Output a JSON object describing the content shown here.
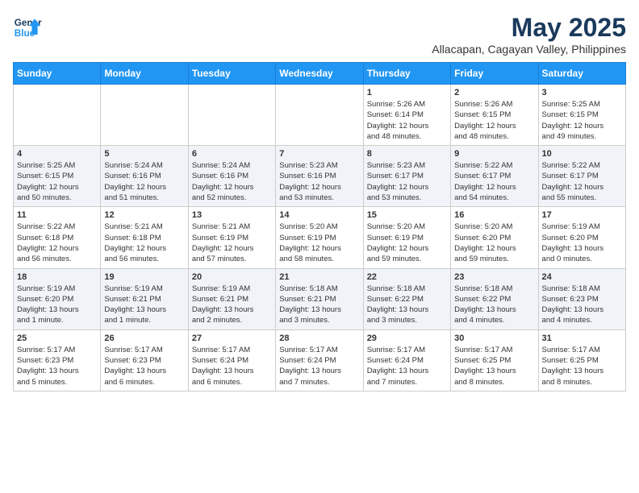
{
  "header": {
    "logo_line1": "General",
    "logo_line2": "Blue",
    "month_title": "May 2025",
    "location": "Allacapan, Cagayan Valley, Philippines"
  },
  "weekdays": [
    "Sunday",
    "Monday",
    "Tuesday",
    "Wednesday",
    "Thursday",
    "Friday",
    "Saturday"
  ],
  "weeks": [
    [
      {
        "day": "",
        "info": ""
      },
      {
        "day": "",
        "info": ""
      },
      {
        "day": "",
        "info": ""
      },
      {
        "day": "",
        "info": ""
      },
      {
        "day": "1",
        "info": "Sunrise: 5:26 AM\nSunset: 6:14 PM\nDaylight: 12 hours\nand 48 minutes."
      },
      {
        "day": "2",
        "info": "Sunrise: 5:26 AM\nSunset: 6:15 PM\nDaylight: 12 hours\nand 48 minutes."
      },
      {
        "day": "3",
        "info": "Sunrise: 5:25 AM\nSunset: 6:15 PM\nDaylight: 12 hours\nand 49 minutes."
      }
    ],
    [
      {
        "day": "4",
        "info": "Sunrise: 5:25 AM\nSunset: 6:15 PM\nDaylight: 12 hours\nand 50 minutes."
      },
      {
        "day": "5",
        "info": "Sunrise: 5:24 AM\nSunset: 6:16 PM\nDaylight: 12 hours\nand 51 minutes."
      },
      {
        "day": "6",
        "info": "Sunrise: 5:24 AM\nSunset: 6:16 PM\nDaylight: 12 hours\nand 52 minutes."
      },
      {
        "day": "7",
        "info": "Sunrise: 5:23 AM\nSunset: 6:16 PM\nDaylight: 12 hours\nand 53 minutes."
      },
      {
        "day": "8",
        "info": "Sunrise: 5:23 AM\nSunset: 6:17 PM\nDaylight: 12 hours\nand 53 minutes."
      },
      {
        "day": "9",
        "info": "Sunrise: 5:22 AM\nSunset: 6:17 PM\nDaylight: 12 hours\nand 54 minutes."
      },
      {
        "day": "10",
        "info": "Sunrise: 5:22 AM\nSunset: 6:17 PM\nDaylight: 12 hours\nand 55 minutes."
      }
    ],
    [
      {
        "day": "11",
        "info": "Sunrise: 5:22 AM\nSunset: 6:18 PM\nDaylight: 12 hours\nand 56 minutes."
      },
      {
        "day": "12",
        "info": "Sunrise: 5:21 AM\nSunset: 6:18 PM\nDaylight: 12 hours\nand 56 minutes."
      },
      {
        "day": "13",
        "info": "Sunrise: 5:21 AM\nSunset: 6:19 PM\nDaylight: 12 hours\nand 57 minutes."
      },
      {
        "day": "14",
        "info": "Sunrise: 5:20 AM\nSunset: 6:19 PM\nDaylight: 12 hours\nand 58 minutes."
      },
      {
        "day": "15",
        "info": "Sunrise: 5:20 AM\nSunset: 6:19 PM\nDaylight: 12 hours\nand 59 minutes."
      },
      {
        "day": "16",
        "info": "Sunrise: 5:20 AM\nSunset: 6:20 PM\nDaylight: 12 hours\nand 59 minutes."
      },
      {
        "day": "17",
        "info": "Sunrise: 5:19 AM\nSunset: 6:20 PM\nDaylight: 13 hours\nand 0 minutes."
      }
    ],
    [
      {
        "day": "18",
        "info": "Sunrise: 5:19 AM\nSunset: 6:20 PM\nDaylight: 13 hours\nand 1 minute."
      },
      {
        "day": "19",
        "info": "Sunrise: 5:19 AM\nSunset: 6:21 PM\nDaylight: 13 hours\nand 1 minute."
      },
      {
        "day": "20",
        "info": "Sunrise: 5:19 AM\nSunset: 6:21 PM\nDaylight: 13 hours\nand 2 minutes."
      },
      {
        "day": "21",
        "info": "Sunrise: 5:18 AM\nSunset: 6:21 PM\nDaylight: 13 hours\nand 3 minutes."
      },
      {
        "day": "22",
        "info": "Sunrise: 5:18 AM\nSunset: 6:22 PM\nDaylight: 13 hours\nand 3 minutes."
      },
      {
        "day": "23",
        "info": "Sunrise: 5:18 AM\nSunset: 6:22 PM\nDaylight: 13 hours\nand 4 minutes."
      },
      {
        "day": "24",
        "info": "Sunrise: 5:18 AM\nSunset: 6:23 PM\nDaylight: 13 hours\nand 4 minutes."
      }
    ],
    [
      {
        "day": "25",
        "info": "Sunrise: 5:17 AM\nSunset: 6:23 PM\nDaylight: 13 hours\nand 5 minutes."
      },
      {
        "day": "26",
        "info": "Sunrise: 5:17 AM\nSunset: 6:23 PM\nDaylight: 13 hours\nand 6 minutes."
      },
      {
        "day": "27",
        "info": "Sunrise: 5:17 AM\nSunset: 6:24 PM\nDaylight: 13 hours\nand 6 minutes."
      },
      {
        "day": "28",
        "info": "Sunrise: 5:17 AM\nSunset: 6:24 PM\nDaylight: 13 hours\nand 7 minutes."
      },
      {
        "day": "29",
        "info": "Sunrise: 5:17 AM\nSunset: 6:24 PM\nDaylight: 13 hours\nand 7 minutes."
      },
      {
        "day": "30",
        "info": "Sunrise: 5:17 AM\nSunset: 6:25 PM\nDaylight: 13 hours\nand 8 minutes."
      },
      {
        "day": "31",
        "info": "Sunrise: 5:17 AM\nSunset: 6:25 PM\nDaylight: 13 hours\nand 8 minutes."
      }
    ]
  ]
}
